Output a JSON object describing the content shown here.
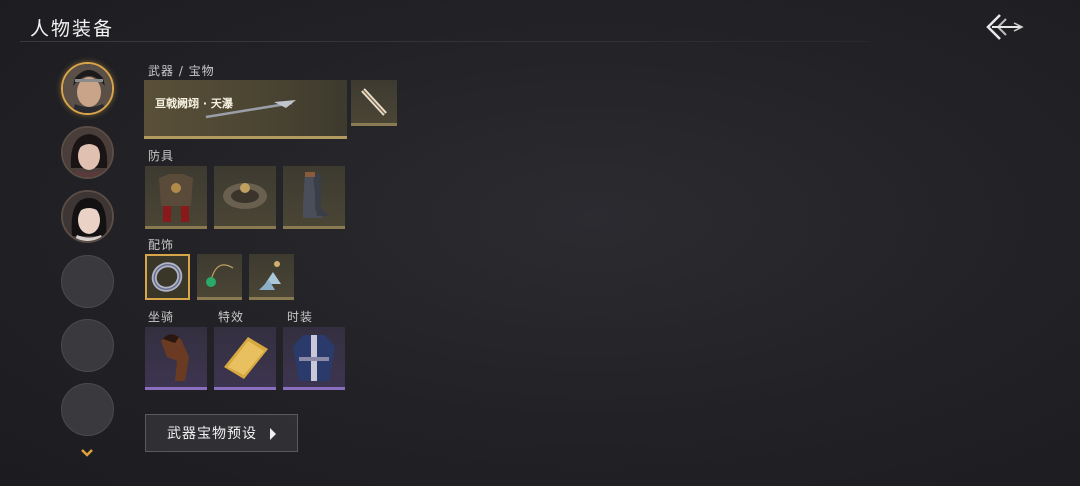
{
  "header": {
    "title": "人物装备"
  },
  "sections": {
    "weapon": {
      "label": "武器 / 宝物",
      "main_item_name": "亘戟阙翊 · 天瀑"
    },
    "armor": {
      "label": "防具"
    },
    "accessory": {
      "label": "配饰"
    },
    "mount": {
      "label": "坐骑"
    },
    "effect": {
      "label": "特效"
    },
    "costume": {
      "label": "时装"
    }
  },
  "preset_button": {
    "label": "武器宝物预设"
  },
  "colors": {
    "accent_gold": "#d9a54a",
    "rarity_purple": "#8a6fbf",
    "rarity_gold": "#b39a5e"
  }
}
